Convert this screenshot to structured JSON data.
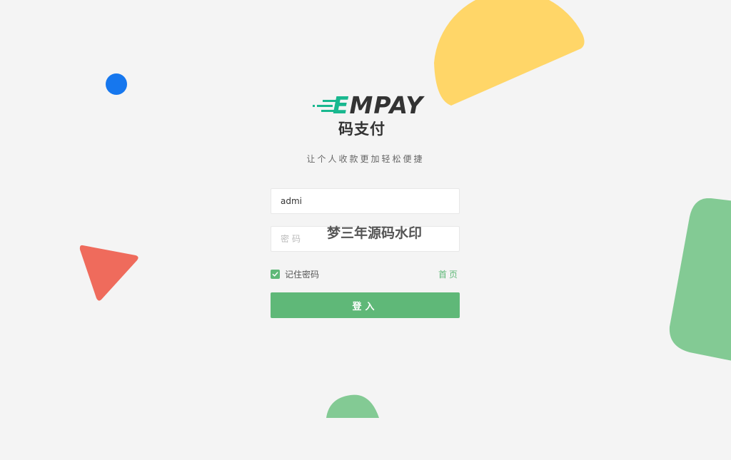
{
  "brand": {
    "logo_prefix": "E",
    "logo_rest": "MPAY",
    "subtitle": "码支付",
    "slogan": "让个人收款更加轻松便捷"
  },
  "login_form": {
    "username_value": "admi",
    "password_placeholder": "密码",
    "remember_label": "记住密码",
    "remember_checked": true,
    "home_link": "首页",
    "submit_label": "登入"
  },
  "watermark": "梦三年源码水印",
  "colors": {
    "background": "#f4f4f4",
    "primary_green": "#5fb878",
    "logo_teal": "#19b88f",
    "yellow_shape": "#ffd668",
    "blue_dot": "#1677ee",
    "red_triangle": "#ef6b5c",
    "green_shape": "#83ca94"
  }
}
